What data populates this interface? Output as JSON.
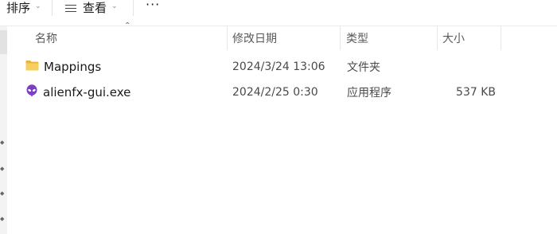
{
  "toolbar": {
    "sort_label": "排序",
    "view_label": "查看",
    "more_label": "···"
  },
  "columns": {
    "name": "名称",
    "modified": "修改日期",
    "type": "类型",
    "size": "大小"
  },
  "files": [
    {
      "name": "Mappings",
      "modified": "2024/3/24 13:06",
      "type": "文件夹",
      "size": "",
      "icon": "folder-icon"
    },
    {
      "name": "alienfx-gui.exe",
      "modified": "2024/2/25 0:30",
      "type": "应用程序",
      "size": "537 KB",
      "icon": "alien-app-icon"
    }
  ],
  "colors": {
    "folder": "#f4c542",
    "app_icon": "#7b3fc4"
  }
}
